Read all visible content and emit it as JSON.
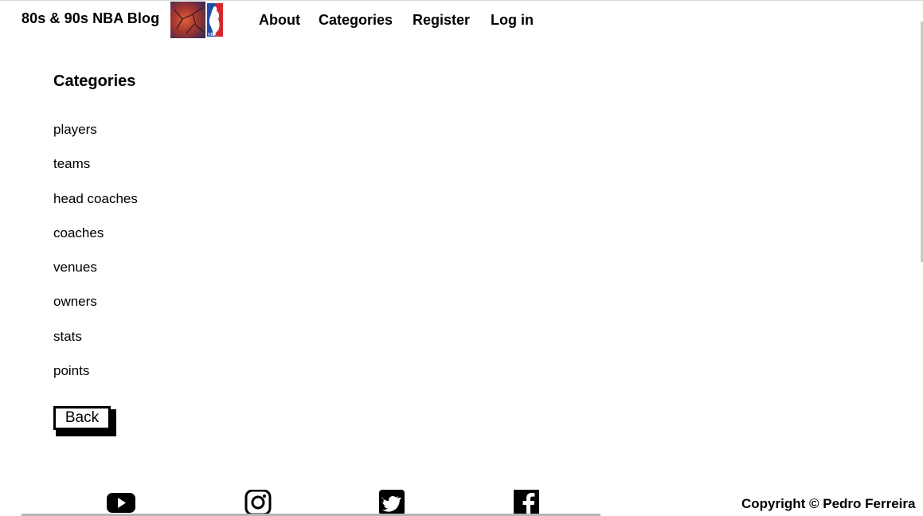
{
  "header": {
    "brand": "80s & 90s NBA Blog",
    "logo_icon": "nba-logo-icon",
    "nav": {
      "about": "About",
      "categories": "Categories",
      "register": "Register",
      "login": "Log in"
    }
  },
  "main": {
    "title": "Categories",
    "categories": [
      "players",
      "teams",
      "head coaches",
      "coaches",
      "venues",
      "owners",
      "stats",
      "points"
    ],
    "back_label": "Back"
  },
  "footer": {
    "social_icons": [
      "youtube-icon",
      "instagram-icon",
      "twitter-icon",
      "facebook-icon"
    ],
    "copyright": "Copyright © Pedro Ferreira"
  }
}
